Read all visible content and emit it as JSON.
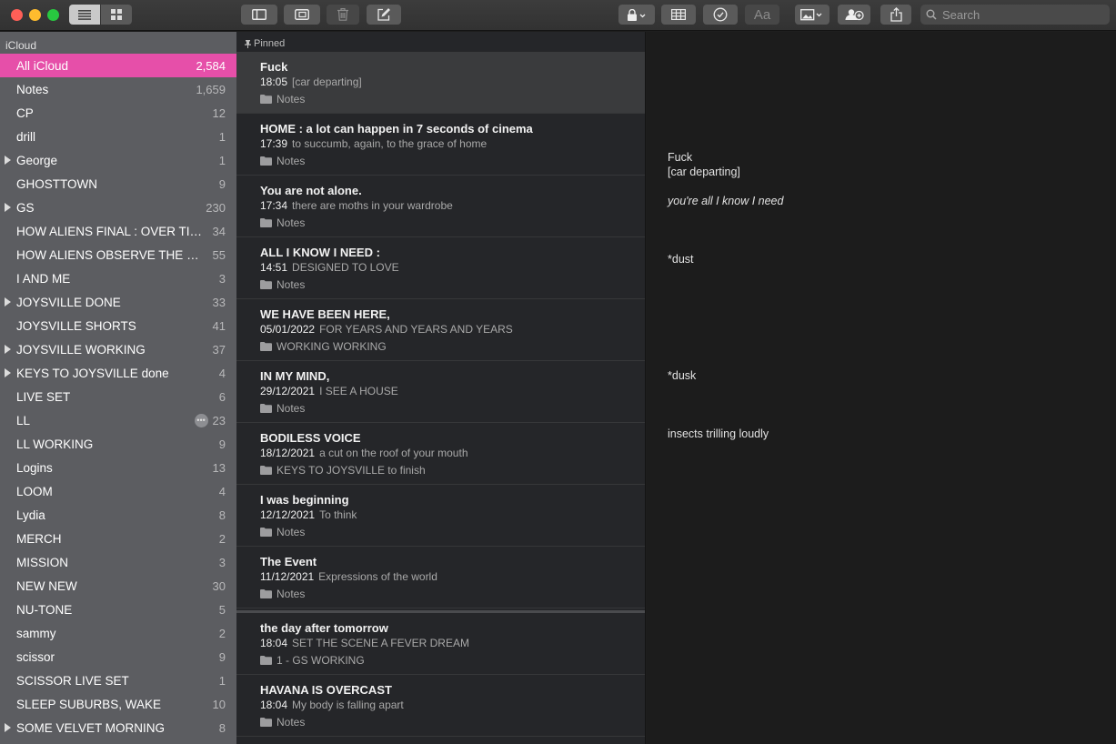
{
  "toolbar": {
    "search_placeholder": "Search",
    "font_button_label": "Aa"
  },
  "sidebar": {
    "section_title": "iCloud",
    "folders": [
      {
        "name": "All iCloud",
        "count": "2,584",
        "active": true
      },
      {
        "name": "Notes",
        "count": "1,659"
      },
      {
        "name": "CP",
        "count": "12"
      },
      {
        "name": "drill",
        "count": "1"
      },
      {
        "name": "George",
        "count": "1",
        "expandable": true
      },
      {
        "name": "GHOSTTOWN",
        "count": "9"
      },
      {
        "name": "GS",
        "count": "230",
        "expandable": true
      },
      {
        "name": "HOW ALIENS FINAL : OVER TIM...",
        "count": "34"
      },
      {
        "name": "HOW ALIENS OBSERVE THE WO...",
        "count": "55"
      },
      {
        "name": "I AND ME",
        "count": "3"
      },
      {
        "name": "JOYSVILLE DONE",
        "count": "33",
        "expandable": true
      },
      {
        "name": "JOYSVILLE SHORTS",
        "count": "41"
      },
      {
        "name": "JOYSVILLE WORKING",
        "count": "37",
        "expandable": true
      },
      {
        "name": "KEYS TO JOYSVILLE done",
        "count": "4",
        "expandable": true
      },
      {
        "name": "LIVE SET",
        "count": "6"
      },
      {
        "name": "LL",
        "count": "23",
        "shared": true
      },
      {
        "name": "LL WORKING",
        "count": "9"
      },
      {
        "name": "Logins",
        "count": "13"
      },
      {
        "name": "LOOM",
        "count": "4"
      },
      {
        "name": "Lydia",
        "count": "8"
      },
      {
        "name": "MERCH",
        "count": "2"
      },
      {
        "name": "MISSION",
        "count": "3"
      },
      {
        "name": "NEW NEW",
        "count": "30"
      },
      {
        "name": "NU-TONE",
        "count": "5"
      },
      {
        "name": "sammy",
        "count": "2"
      },
      {
        "name": "scissor",
        "count": "9"
      },
      {
        "name": "SCISSOR LIVE SET",
        "count": "1"
      },
      {
        "name": "SLEEP SUBURBS, WAKE",
        "count": "10"
      },
      {
        "name": "SOME VELVET MORNING",
        "count": "8",
        "expandable": true
      }
    ]
  },
  "list": {
    "pinned_label": "Pinned",
    "pinned_notes": [
      {
        "title": "Fuck",
        "date": "18:05",
        "preview": "[car departing]",
        "folder": "Notes",
        "selected": true
      },
      {
        "title": "HOME : a lot can happen in 7 seconds of cinema",
        "date": "17:39",
        "preview": "to succumb, again, to the grace of home",
        "folder": "Notes"
      },
      {
        "title": "You are not alone.",
        "date": "17:34",
        "preview": "there are moths in your wardrobe",
        "folder": "Notes"
      },
      {
        "title": "ALL I KNOW I NEED :",
        "date": "14:51",
        "preview": "DESIGNED TO LOVE",
        "folder": "Notes"
      },
      {
        "title": "WE HAVE BEEN HERE,",
        "date": "05/01/2022",
        "preview": "FOR YEARS AND YEARS AND YEARS",
        "folder": "WORKING WORKING"
      },
      {
        "title": "IN MY MIND,",
        "date": "29/12/2021",
        "preview": "I SEE A HOUSE",
        "folder": "Notes"
      },
      {
        "title": "BODILESS VOICE",
        "date": "18/12/2021",
        "preview": "a cut on the roof of your mouth",
        "folder": "KEYS TO JOYSVILLE to finish"
      },
      {
        "title": "I was beginning",
        "date": "12/12/2021",
        "preview": "To think",
        "folder": "Notes"
      },
      {
        "title": "The Event",
        "date": "11/12/2021",
        "preview": "Expressions of the world",
        "folder": "Notes"
      }
    ],
    "notes": [
      {
        "title": "the day after tomorrow",
        "date": "18:04",
        "preview": "SET THE SCENE A FEVER DREAM",
        "folder": "1 - GS WORKING"
      },
      {
        "title": "HAVANA IS OVERCAST",
        "date": "18:04",
        "preview": "My body is falling apart",
        "folder": "Notes"
      }
    ]
  },
  "editor": {
    "lines": [
      {
        "text": "Fuck",
        "italic": false
      },
      {
        "text": "[car departing]",
        "italic": false
      },
      {
        "text": "you're all I know I need",
        "italic": true
      },
      {
        "text": "*dust",
        "italic": false
      },
      {
        "text": "*dusk",
        "italic": false
      },
      {
        "text": "insects trilling loudly",
        "italic": false
      }
    ]
  }
}
